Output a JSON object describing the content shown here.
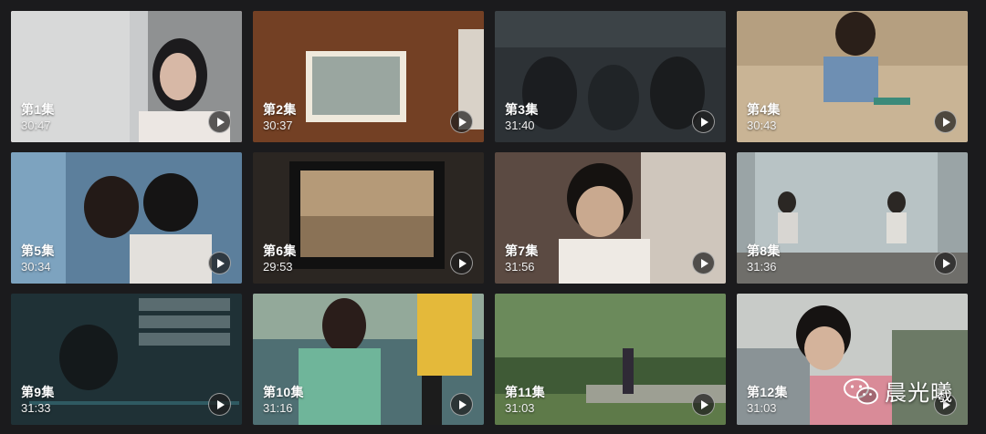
{
  "episodes": [
    {
      "label": "第1集",
      "duration": "30:47",
      "selected": true
    },
    {
      "label": "第2集",
      "duration": "30:37",
      "selected": false
    },
    {
      "label": "第3集",
      "duration": "31:40",
      "selected": false
    },
    {
      "label": "第4集",
      "duration": "30:43",
      "selected": false
    },
    {
      "label": "第5集",
      "duration": "30:34",
      "selected": false
    },
    {
      "label": "第6集",
      "duration": "29:53",
      "selected": false
    },
    {
      "label": "第7集",
      "duration": "31:56",
      "selected": false
    },
    {
      "label": "第8集",
      "duration": "31:36",
      "selected": false
    },
    {
      "label": "第9集",
      "duration": "31:33",
      "selected": false
    },
    {
      "label": "第10集",
      "duration": "31:16",
      "selected": false
    },
    {
      "label": "第11集",
      "duration": "31:03",
      "selected": false
    },
    {
      "label": "第12集",
      "duration": "31:03",
      "selected": false
    }
  ],
  "watermark": {
    "text": "晨光曦"
  },
  "colors": {
    "background": "#1b1b1d",
    "selected_border": "#d21f4a"
  }
}
